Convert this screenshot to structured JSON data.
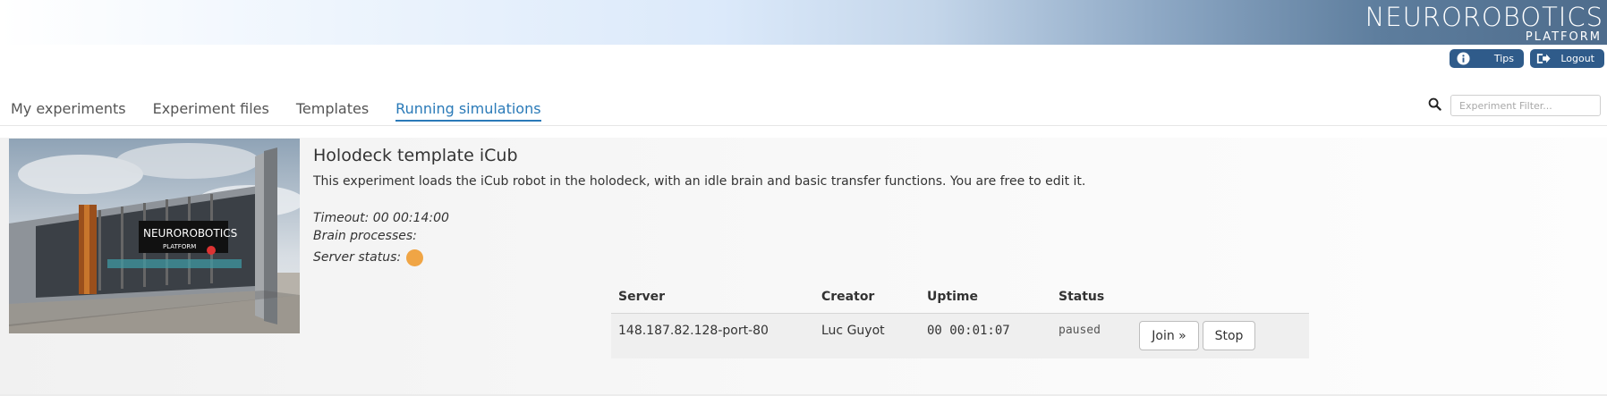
{
  "logo": {
    "main": "NEUROROBOTICS",
    "sub": "PLATFORM"
  },
  "header": {
    "tips_label": "Tips",
    "logout_label": "Logout",
    "tips_icon": "info-icon",
    "logout_icon": "logout-icon",
    "button_color": "#2f5b8a"
  },
  "tabs": [
    {
      "label": "My experiments",
      "active": false
    },
    {
      "label": "Experiment files",
      "active": false
    },
    {
      "label": "Templates",
      "active": false
    },
    {
      "label": "Running simulations",
      "active": true
    }
  ],
  "search": {
    "placeholder": "Experiment Filter...",
    "icon": "search-icon"
  },
  "experiment": {
    "title": "Holodeck template iCub",
    "description": "This experiment loads the iCub robot in the holodeck, with an idle brain and basic transfer functions. You are free to edit it.",
    "timeout": "Timeout: 00 00:14:00",
    "brain_processes": "Brain processes:",
    "server_status_label": "Server status:",
    "server_status_color": "#f0a545",
    "thumbnail_logo_main": "NEUROROBOTICS",
    "thumbnail_logo_sub": "PLATFORM"
  },
  "simulations": {
    "headers": {
      "server": "Server",
      "creator": "Creator",
      "uptime": "Uptime",
      "status": "Status"
    },
    "rows": [
      {
        "server": "148.187.82.128-port-80",
        "creator": "Luc Guyot",
        "uptime": "00 00:01:07",
        "status": "paused",
        "join_label": "Join »",
        "stop_label": "Stop"
      }
    ]
  },
  "colors": {
    "accent": "#2a7ab8"
  }
}
